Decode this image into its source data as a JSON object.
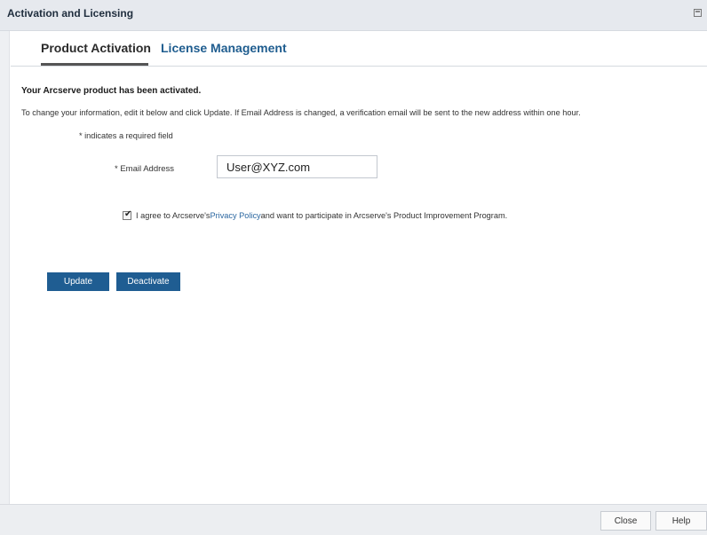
{
  "window": {
    "title": "Activation and Licensing",
    "restore_icon": "window-restore-icon"
  },
  "tabs": [
    {
      "label": "Product Activation",
      "active": true
    },
    {
      "label": "License Management",
      "active": false
    }
  ],
  "activation": {
    "status": "Your Arcserve product has been activated.",
    "instructions": "To change your information, edit it below and click Update. If Email Address is changed, a verification email will be sent to the new address within one hour.",
    "required_note": "* indicates a required field",
    "email_label": "* Email Address",
    "email_value": "User@XYZ.com",
    "agree_checked": true,
    "agree_prefix": "I agree to Arcserve's ",
    "privacy_link": "Privacy Policy",
    "agree_suffix": " and want to participate in Arcserve's Product Improvement Program.",
    "update_label": "Update",
    "deactivate_label": "Deactivate"
  },
  "footer": {
    "close_label": "Close",
    "help_label": "Help"
  },
  "colors": {
    "primary_button": "#1f5d92",
    "link": "#2a66a0",
    "tab_inactive": "#1f5d8f"
  }
}
